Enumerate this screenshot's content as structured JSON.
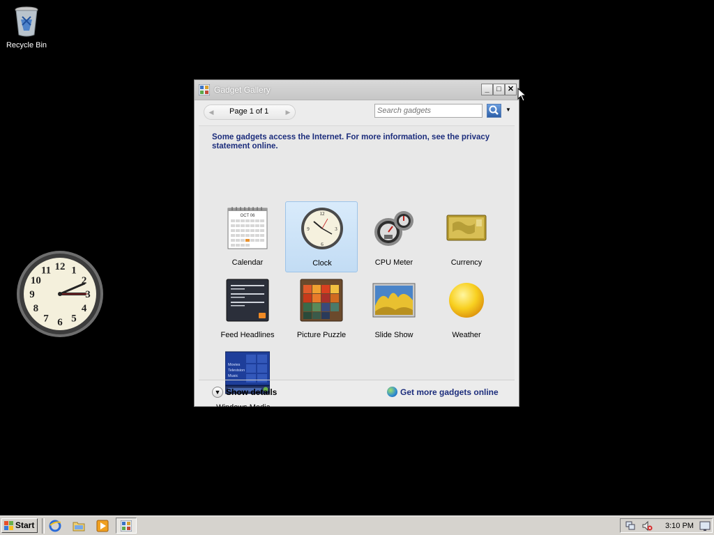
{
  "desktop": {
    "recycle_bin_label": "Recycle Bin",
    "clock_gadget": {
      "time": "3:10",
      "numbers": [
        "12",
        "1",
        "2",
        "3",
        "4",
        "5",
        "6",
        "7",
        "8",
        "9",
        "10",
        "11"
      ]
    }
  },
  "window": {
    "title": "Gadget Gallery",
    "controls": {
      "minimize": "_",
      "maximize": "□",
      "close": "✕"
    },
    "pager_text": "Page 1 of 1",
    "search_placeholder": "Search gadgets",
    "notice": "Some gadgets access the Internet.  For more information, see the privacy statement online.",
    "gadgets": [
      {
        "name": "Calendar",
        "selected": false,
        "icon": "calendar-icon"
      },
      {
        "name": "Clock",
        "selected": true,
        "icon": "clock-icon"
      },
      {
        "name": "CPU Meter",
        "selected": false,
        "icon": "cpu-meter-icon"
      },
      {
        "name": "Currency",
        "selected": false,
        "icon": "currency-icon"
      },
      {
        "name": "Feed Headlines",
        "selected": false,
        "icon": "feed-headlines-icon"
      },
      {
        "name": "Picture Puzzle",
        "selected": false,
        "icon": "picture-puzzle-icon"
      },
      {
        "name": "Slide Show",
        "selected": false,
        "icon": "slide-show-icon"
      },
      {
        "name": "Weather",
        "selected": false,
        "icon": "weather-icon"
      },
      {
        "name": "Windows Media ...",
        "selected": false,
        "icon": "windows-media-center-icon"
      }
    ],
    "calendar_thumb": {
      "month": "OCT 06"
    },
    "media_thumb": {
      "lines": [
        "Movies",
        "Television",
        "Music"
      ]
    },
    "footer": {
      "show_details": "Show details",
      "get_more": "Get more gadgets online"
    }
  },
  "taskbar": {
    "start_label": "Start",
    "clock": "3:10 PM"
  },
  "colors": {
    "notice_text": "#1c2d7c",
    "selected_bg": "#c9e0f6",
    "desktop_bg": "#000000"
  }
}
